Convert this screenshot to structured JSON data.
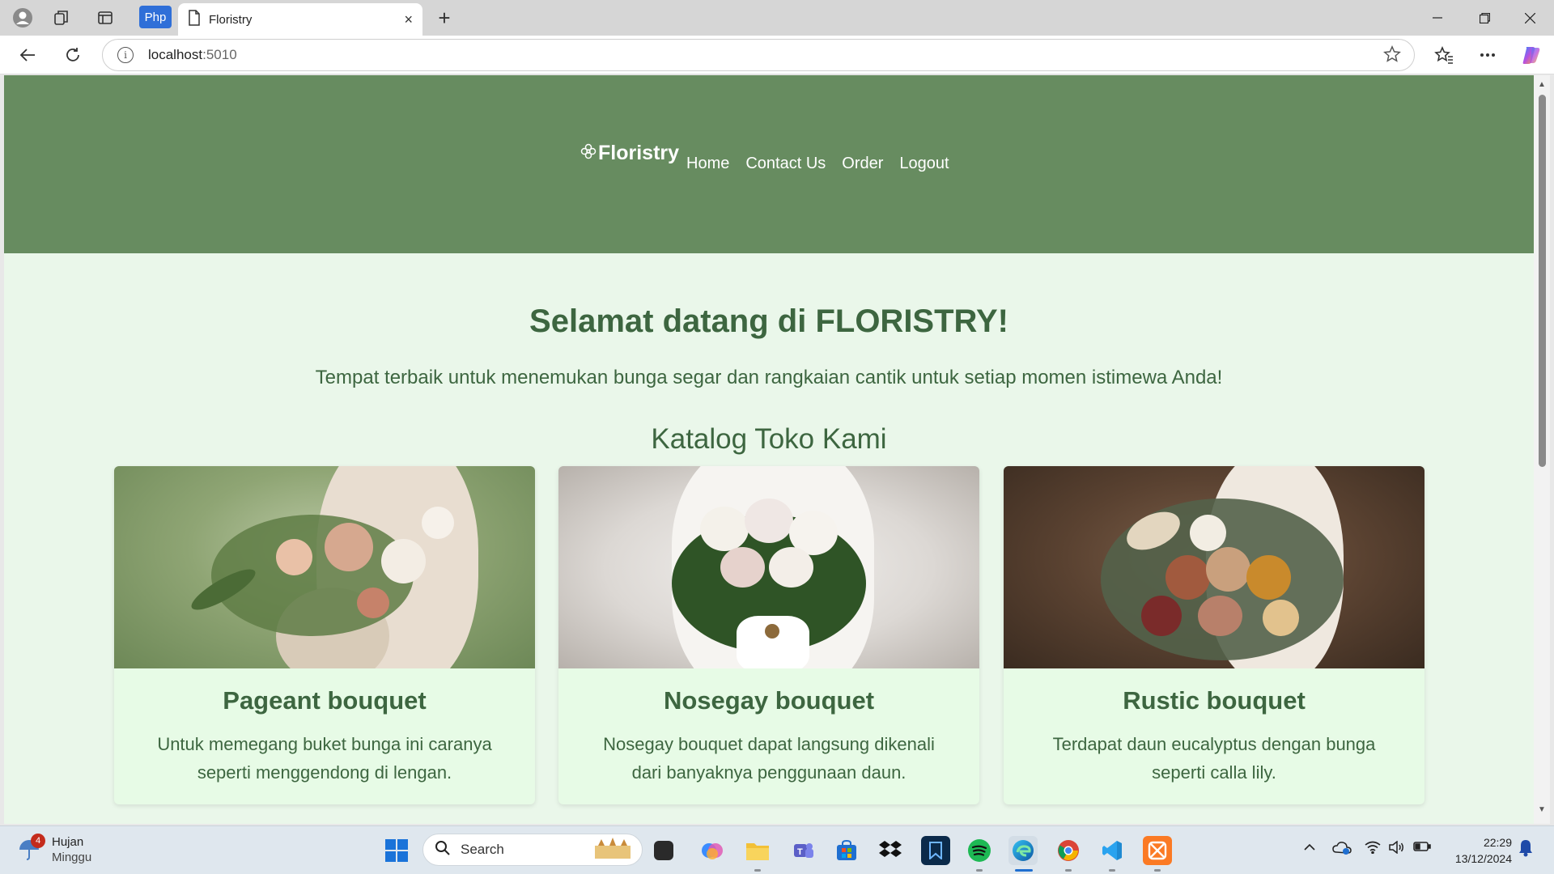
{
  "browser": {
    "php_label": "Php",
    "tab_title": "Floristry",
    "tab_close": "×",
    "new_tab": "+",
    "url_host": "localhost",
    "url_port": ":5010"
  },
  "site": {
    "brand": "Floristry",
    "brand_icon": "flower-icon",
    "nav": [
      {
        "label": "Home"
      },
      {
        "label": "Contact Us"
      },
      {
        "label": "Order"
      },
      {
        "label": "Logout"
      }
    ],
    "hero_title": "Selamat datang di FLORISTRY!",
    "hero_subtitle": "Tempat terbaik untuk menemukan bunga segar dan rangkaian cantik untuk setiap momen istimewa Anda!",
    "catalog_title": "Katalog Toko Kami",
    "cards": [
      {
        "title": "Pageant bouquet",
        "description": "Untuk memegang buket bunga ini caranya seperti menggendong di lengan."
      },
      {
        "title": "Nosegay bouquet",
        "description": "Nosegay bouquet dapat langsung dikenali dari banyaknya penggunaan daun."
      },
      {
        "title": "Rustic bouquet",
        "description": "Terdapat daun eucalyptus dengan bunga seperti calla lily."
      }
    ]
  },
  "taskbar": {
    "weather_badge": "4",
    "weather_title": "Hujan",
    "weather_sub": "Minggu",
    "search_placeholder": "Search",
    "time": "22:29",
    "date": "13/12/2024"
  },
  "colors": {
    "header_green": "#678c60",
    "page_bg": "#eaf7ea",
    "text_green": "#3d6640",
    "card_bg": "#e7fbe6"
  }
}
